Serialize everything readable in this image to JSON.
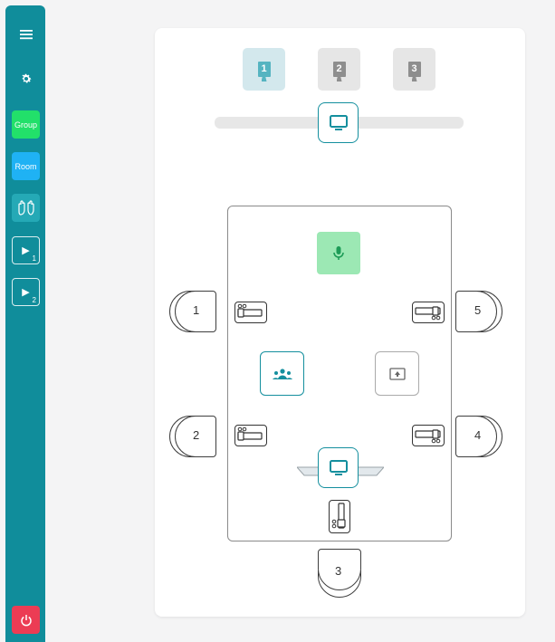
{
  "sidebar": {
    "menu_icon": "hamburger-menu-icon",
    "settings_icon": "gear-icon",
    "group_label": "Group",
    "room_label": "Room",
    "hands_icon": "raised-hands-icon",
    "play1_sub": "1",
    "play2_sub": "2",
    "power_icon": "power-icon",
    "colors": {
      "bg": "#108d9b",
      "group": "#22e06a",
      "room": "#1fb2f4",
      "power": "#ec3c54"
    }
  },
  "displays": [
    {
      "number": "1",
      "selected": true
    },
    {
      "number": "2",
      "selected": false
    },
    {
      "number": "3",
      "selected": false
    }
  ],
  "seats": {
    "s1": "1",
    "s2": "2",
    "s3": "3",
    "s4": "4",
    "s5": "5"
  },
  "icons": {
    "monitor": "monitor-icon",
    "mic": "microphone-icon",
    "people": "people-group-icon",
    "share": "screen-share-icon",
    "controller": "slider-controller-icon"
  },
  "colors": {
    "accent": "#148f9e",
    "mic_bg": "#9ce8b4",
    "mic_icon": "#1d9c57"
  }
}
